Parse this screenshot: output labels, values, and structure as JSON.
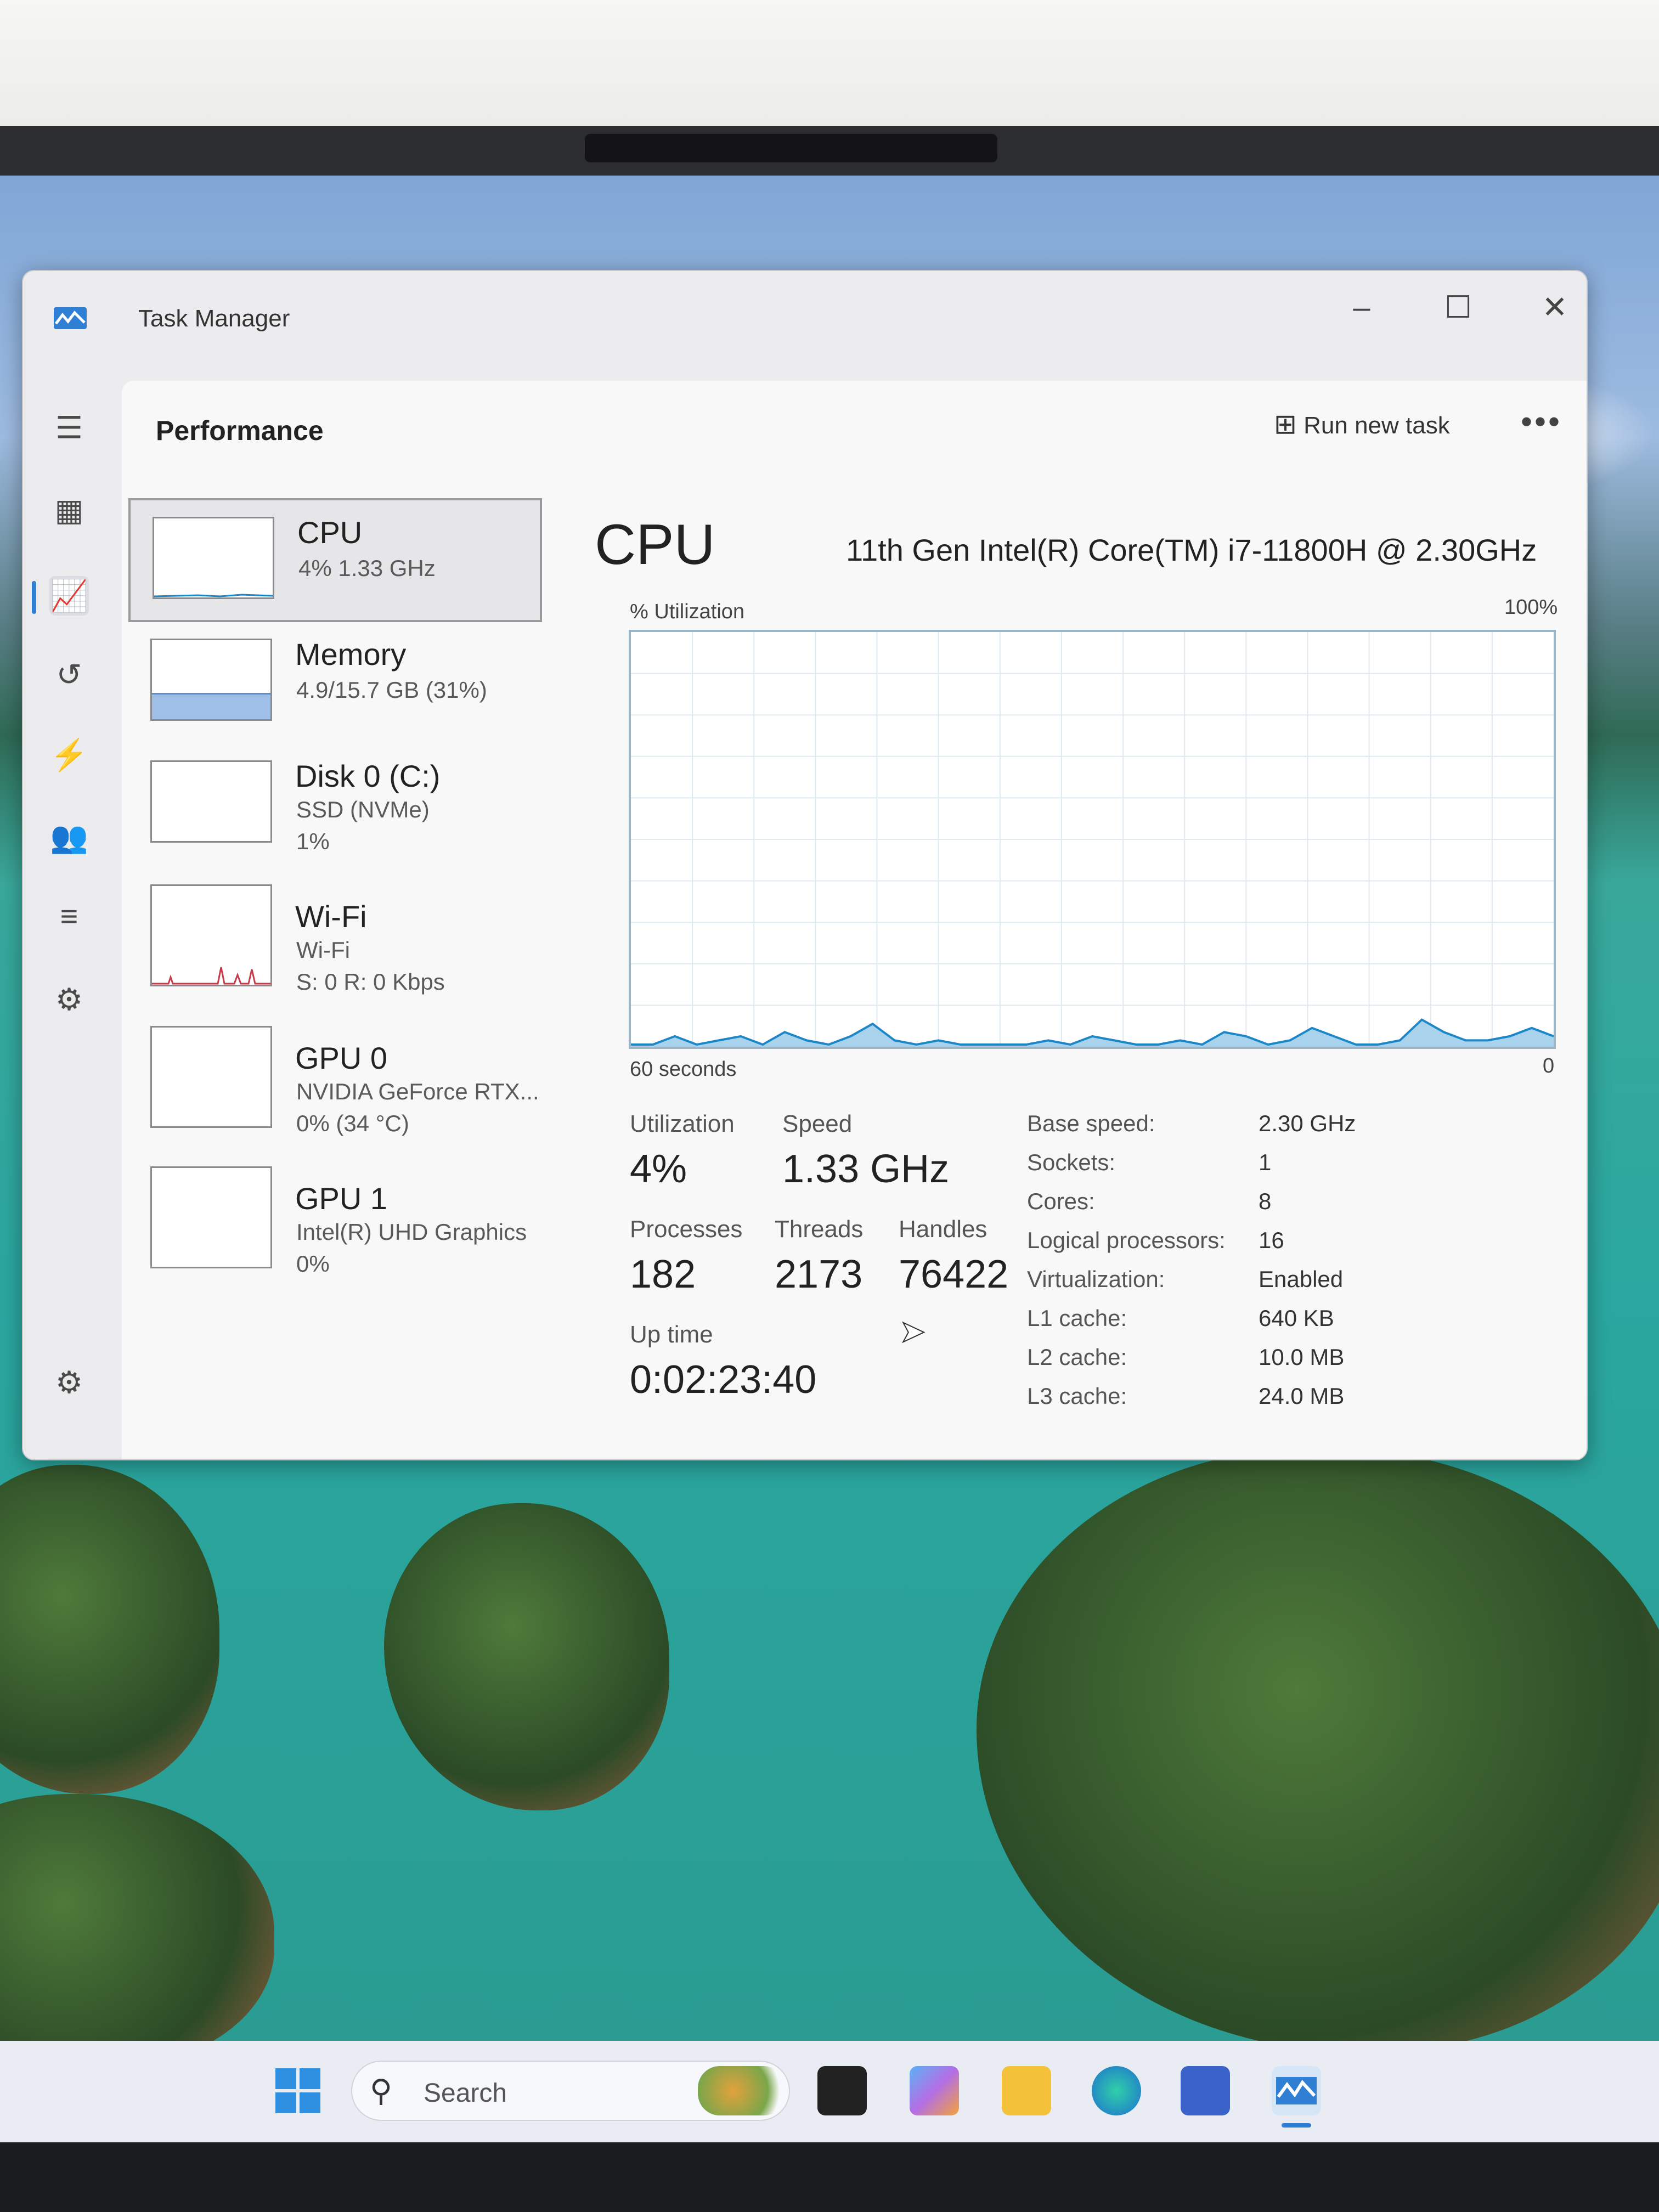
{
  "window": {
    "title": "Task Manager"
  },
  "header": {
    "section": "Performance",
    "run_new_task": "Run new task",
    "more": "•••"
  },
  "devices": [
    {
      "name": "CPU",
      "line1": "4%  1.33 GHz",
      "line2": ""
    },
    {
      "name": "Memory",
      "line1": "4.9/15.7 GB (31%)",
      "line2": ""
    },
    {
      "name": "Disk 0 (C:)",
      "line1": "SSD (NVMe)",
      "line2": "1%"
    },
    {
      "name": "Wi-Fi",
      "line1": "Wi-Fi",
      "line2": "S: 0  R: 0 Kbps"
    },
    {
      "name": "GPU 0",
      "line1": "NVIDIA GeForce RTX...",
      "line2": "0%  (34 °C)"
    },
    {
      "name": "GPU 1",
      "line1": "Intel(R) UHD Graphics",
      "line2": "0%"
    }
  ],
  "detail": {
    "title": "CPU",
    "processor": "11th Gen Intel(R) Core(TM) i7-11800H @ 2.30GHz",
    "graph_label": "% Utilization",
    "graph_max": "100%",
    "graph_span": "60 seconds",
    "graph_min": "0",
    "stats": {
      "utilization_label": "Utilization",
      "utilization": "4%",
      "speed_label": "Speed",
      "speed": "1.33 GHz",
      "processes_label": "Processes",
      "processes": "182",
      "threads_label": "Threads",
      "threads": "2173",
      "handles_label": "Handles",
      "handles": "76422",
      "uptime_label": "Up time",
      "uptime": "0:02:23:40"
    },
    "specs": [
      {
        "label": "Base speed:",
        "value": "2.30 GHz"
      },
      {
        "label": "Sockets:",
        "value": "1"
      },
      {
        "label": "Cores:",
        "value": "8"
      },
      {
        "label": "Logical processors:",
        "value": "16"
      },
      {
        "label": "Virtualization:",
        "value": "Enabled"
      },
      {
        "label": "L1 cache:",
        "value": "640 KB"
      },
      {
        "label": "L2 cache:",
        "value": "10.0 MB"
      },
      {
        "label": "L3 cache:",
        "value": "24.0 MB"
      }
    ]
  },
  "memory_usage_fraction": 0.31,
  "cpu_history_percent": [
    0,
    0,
    2,
    0,
    1,
    2,
    0,
    3,
    1,
    0,
    2,
    5,
    1,
    0,
    1,
    0,
    0,
    0,
    0,
    1,
    0,
    2,
    1,
    0,
    0,
    1,
    0,
    3,
    2,
    0,
    1,
    4,
    2,
    0,
    0,
    1,
    6,
    3,
    1,
    1,
    2,
    4,
    2
  ],
  "taskbar": {
    "search_placeholder": "Search"
  },
  "colors": {
    "accent": "#2f7fd4",
    "graph_line": "#1b87c8",
    "graph_fill": "#a9d3ec",
    "memory_fill": "#9fbfe6",
    "wifi_spikes": "#c73a4a"
  }
}
